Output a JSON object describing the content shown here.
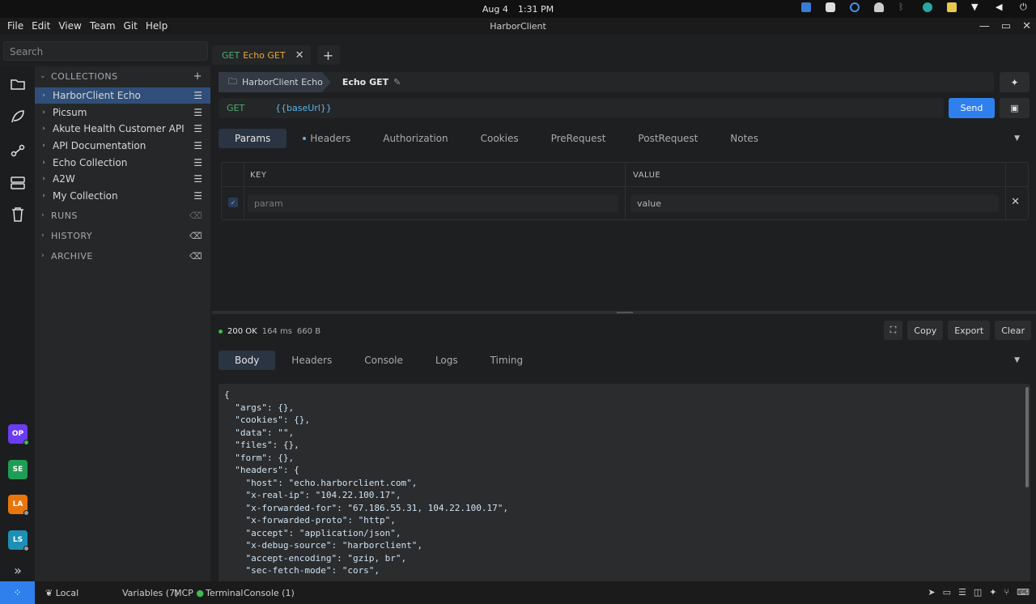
{
  "system": {
    "date": "Aug 4",
    "time": "1:31 PM"
  },
  "menu": [
    "File",
    "Edit",
    "View",
    "Team",
    "Git",
    "Help"
  ],
  "window_title": "HarborClient",
  "sidebar": {
    "search_placeholder": "Search",
    "collections_label": "COLLECTIONS",
    "collections": [
      "HarborClient Echo",
      "Picsum",
      "Akute Health Customer API",
      "API Documentation",
      "Echo Collection",
      "A2W",
      "My Collection"
    ],
    "runs_label": "RUNS",
    "history_label": "HISTORY",
    "archive_label": "ARCHIVE"
  },
  "rail": {
    "avatars": [
      {
        "initials": "OP",
        "color": "#6a3df0",
        "status": "#3fb950"
      },
      {
        "initials": "SE",
        "color": "#1f9d55",
        "status": ""
      },
      {
        "initials": "LA",
        "color": "#e8760d",
        "status": "#9a9a9a"
      },
      {
        "initials": "LS",
        "color": "#1e8fb5",
        "status": "#9a9a9a"
      }
    ]
  },
  "tab": {
    "method": "GET",
    "name": "Echo GET"
  },
  "breadcrumb": {
    "collection": "HarborClient Echo",
    "request": "Echo GET"
  },
  "request": {
    "method": "GET",
    "url": "{{baseUrl}}",
    "send_label": "Send"
  },
  "request_tabs": [
    "Params",
    "Headers",
    "Authorization",
    "Cookies",
    "PreRequest",
    "PostRequest",
    "Notes"
  ],
  "params": {
    "key_header": "KEY",
    "value_header": "VALUE",
    "key_placeholder": "param",
    "value_placeholder": "value"
  },
  "response": {
    "status": "200 OK",
    "time": "164 ms",
    "size": "660 B",
    "buttons": [
      "Copy",
      "Export",
      "Clear"
    ],
    "tabs": [
      "Body",
      "Headers",
      "Console",
      "Logs",
      "Timing"
    ],
    "body_lines": [
      "{",
      "  \"args\": {},",
      "  \"cookies\": {},",
      "  \"data\": \"\",",
      "  \"files\": {},",
      "  \"form\": {},",
      "  \"headers\": {",
      "    \"host\": \"echo.harborclient.com\",",
      "    \"x-real-ip\": \"104.22.100.17\",",
      "    \"x-forwarded-for\": \"67.186.55.31, 104.22.100.17\",",
      "    \"x-forwarded-proto\": \"http\",",
      "    \"accept\": \"application/json\",",
      "    \"x-debug-source\": \"harborclient\",",
      "    \"accept-encoding\": \"gzip, br\",",
      "    \"sec-fetch-mode\": \"cors\","
    ]
  },
  "bottom": {
    "env": "Local",
    "variables": "Variables (7)",
    "mcp": "MCP",
    "terminal": "Terminal",
    "console": "Console (1)"
  }
}
